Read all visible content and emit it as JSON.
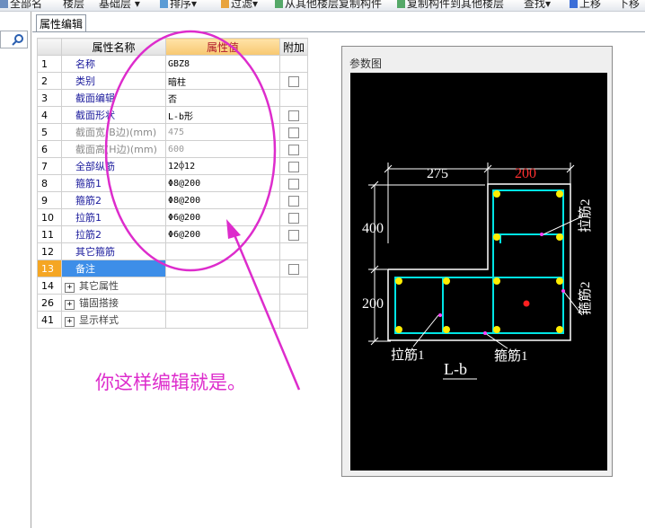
{
  "toolbar": {
    "items": [
      "全部名",
      "楼层",
      "基础层",
      "排序",
      "过滤",
      "从其他楼层复制构件",
      "复制构件到其他楼层",
      "查找",
      "上移",
      "下移"
    ]
  },
  "tab": {
    "label": "属性编辑"
  },
  "grid": {
    "headers": {
      "name": "属性名称",
      "value": "属性值",
      "add": "附加"
    },
    "rows": [
      {
        "num": "1",
        "name": "名称",
        "value": "GBZ8"
      },
      {
        "num": "2",
        "name": "类别",
        "value": "暗柱"
      },
      {
        "num": "3",
        "name": "截面编辑",
        "value": "否"
      },
      {
        "num": "4",
        "name": "截面形状",
        "value": "L-b形"
      },
      {
        "num": "5",
        "name": "截面宽(B边)(mm)",
        "value": "475"
      },
      {
        "num": "6",
        "name": "截面高(H边)(mm)",
        "value": "600"
      },
      {
        "num": "7",
        "name": "全部纵筋",
        "value": "12⌽12"
      },
      {
        "num": "8",
        "name": "箍筋1",
        "value": "Φ8@200"
      },
      {
        "num": "9",
        "name": "箍筋2",
        "value": "Φ8@200"
      },
      {
        "num": "10",
        "name": "拉筋1",
        "value": "Φ6@200"
      },
      {
        "num": "11",
        "name": "拉筋2",
        "value": "Φ6@200"
      },
      {
        "num": "12",
        "name": "其它箍筋",
        "value": ""
      },
      {
        "num": "13",
        "name": "备注",
        "value": ""
      },
      {
        "num": "14",
        "name": "其它属性",
        "value": ""
      },
      {
        "num": "26",
        "name": "锚固搭接",
        "value": ""
      },
      {
        "num": "41",
        "name": "显示样式",
        "value": ""
      }
    ]
  },
  "annotation": {
    "text": "你这样编辑就是。"
  },
  "panel": {
    "title": "参数图",
    "drawing": {
      "dim_top_left": "275",
      "dim_top_right": "200",
      "dim_left_upper": "400",
      "dim_left_lower": "200",
      "label_tie1": "拉筋1",
      "label_stirrup1": "箍筋1",
      "label_tie2": "拉筋2",
      "label_stirrup2": "箍筋2",
      "shape_name": "L-b"
    }
  },
  "colors": {
    "annotation": "#dd2ccc",
    "header_value": "#b0182a",
    "selected_row": "#3d8ee8",
    "rebar": "#00e5e5",
    "dot": "#ffee00"
  }
}
